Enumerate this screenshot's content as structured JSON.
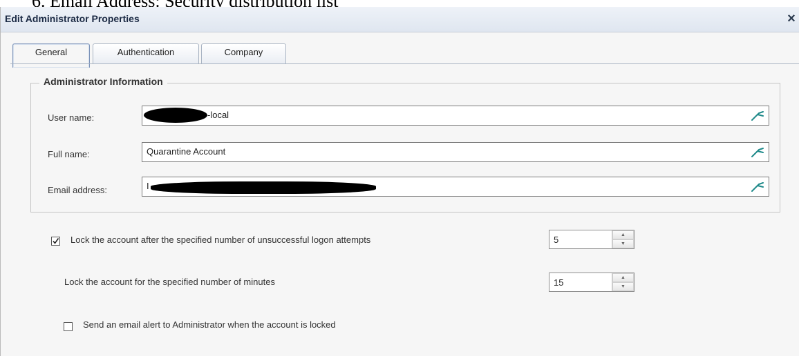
{
  "doc_fragment": "6.   Email Address: Security distribution list",
  "dialog": {
    "title": "Edit Administrator Properties",
    "close_glyph": "×"
  },
  "tabs": [
    {
      "label": "General",
      "active": true
    },
    {
      "label": "Authentication",
      "active": false
    },
    {
      "label": "Company",
      "active": false
    }
  ],
  "admin_info": {
    "legend": "Administrator Information",
    "user_name": {
      "label": "User name:",
      "value": "-local",
      "redacted": true
    },
    "full_name": {
      "label": "Full name:",
      "value": "Quarantine Account"
    },
    "email": {
      "label": "Email address:",
      "value": "I",
      "redacted": true
    },
    "picker_icon": "picker-icon"
  },
  "lockout": {
    "attempts": {
      "label": "Lock the account after the specified number of unsuccessful logon attempts",
      "checked": true,
      "value": "5"
    },
    "minutes": {
      "label": "Lock the account for the specified number of minutes",
      "value": "15"
    },
    "email_alert": {
      "label": "Send an email alert to Administrator when the account is locked",
      "checked": false
    }
  },
  "colors": {
    "accent_icon": "#1f8a8a",
    "title_text": "#1b2a44"
  }
}
